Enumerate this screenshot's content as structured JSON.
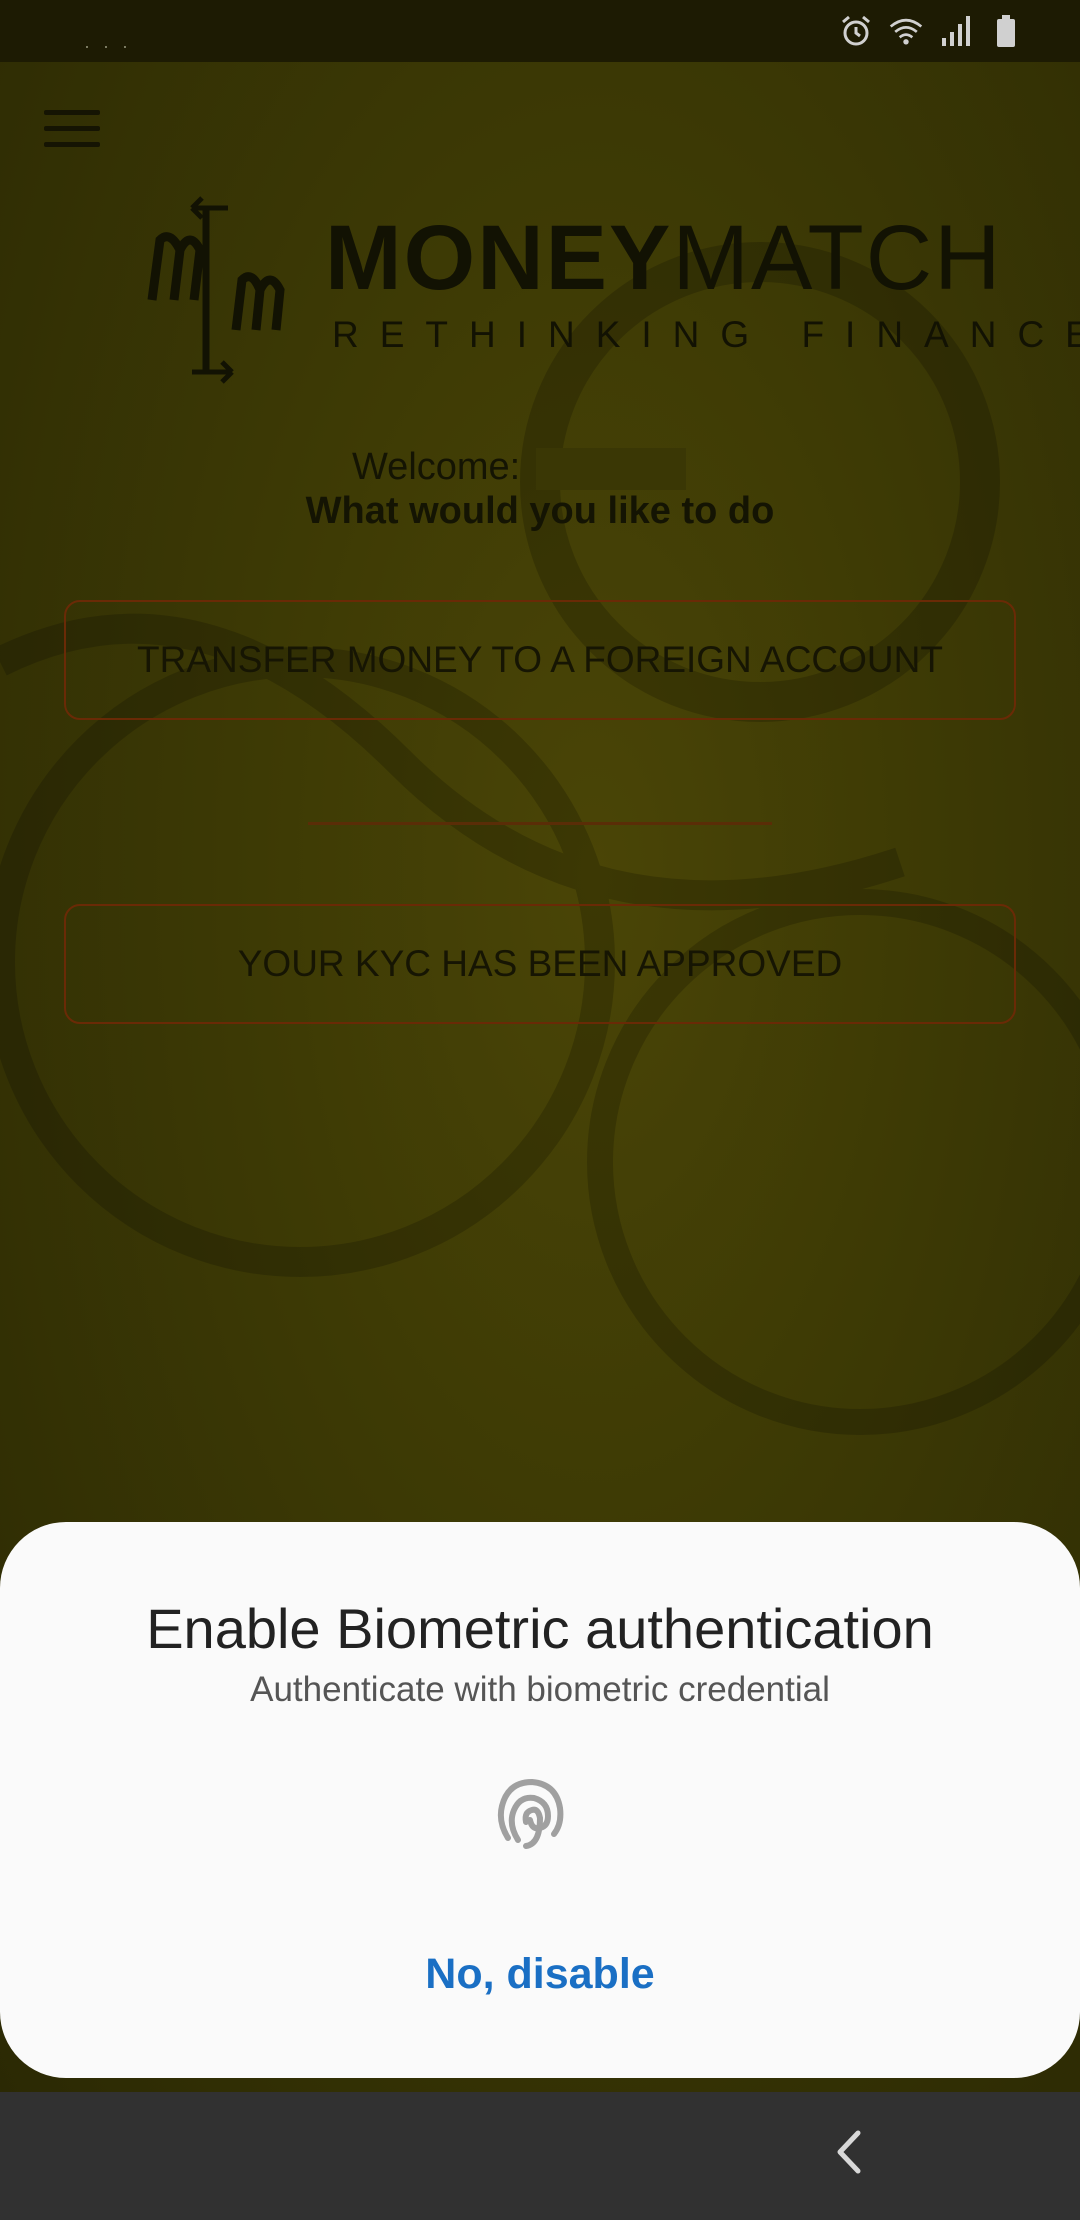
{
  "status_bar": {
    "icons": [
      "alarm-icon",
      "wifi-icon",
      "signal-icon",
      "battery-icon"
    ]
  },
  "header": {
    "menu_icon": "hamburger-menu-icon",
    "logo": {
      "brand_bold": "MONEY",
      "brand_thin": "MATCH",
      "tagline": "RETHINKING FINANCE"
    }
  },
  "main": {
    "welcome_label": "Welcome:",
    "question": "What would you like to do",
    "transfer_button": "TRANSFER MONEY TO A FOREIGN ACCOUNT",
    "kyc_button": "YOUR KYC HAS BEEN APPROVED"
  },
  "dialog": {
    "title": "Enable Biometric authentication",
    "subtitle": "Authenticate with biometric credential",
    "icon": "fingerprint-icon",
    "action": "No, disable"
  },
  "nav_bar": {
    "back_icon": "back-chevron-icon"
  },
  "colors": {
    "overlay_bg": "#3d3a05",
    "button_border": "#6a2a06",
    "sheet_bg": "#fafafa",
    "accent": "#1a6fc4"
  }
}
